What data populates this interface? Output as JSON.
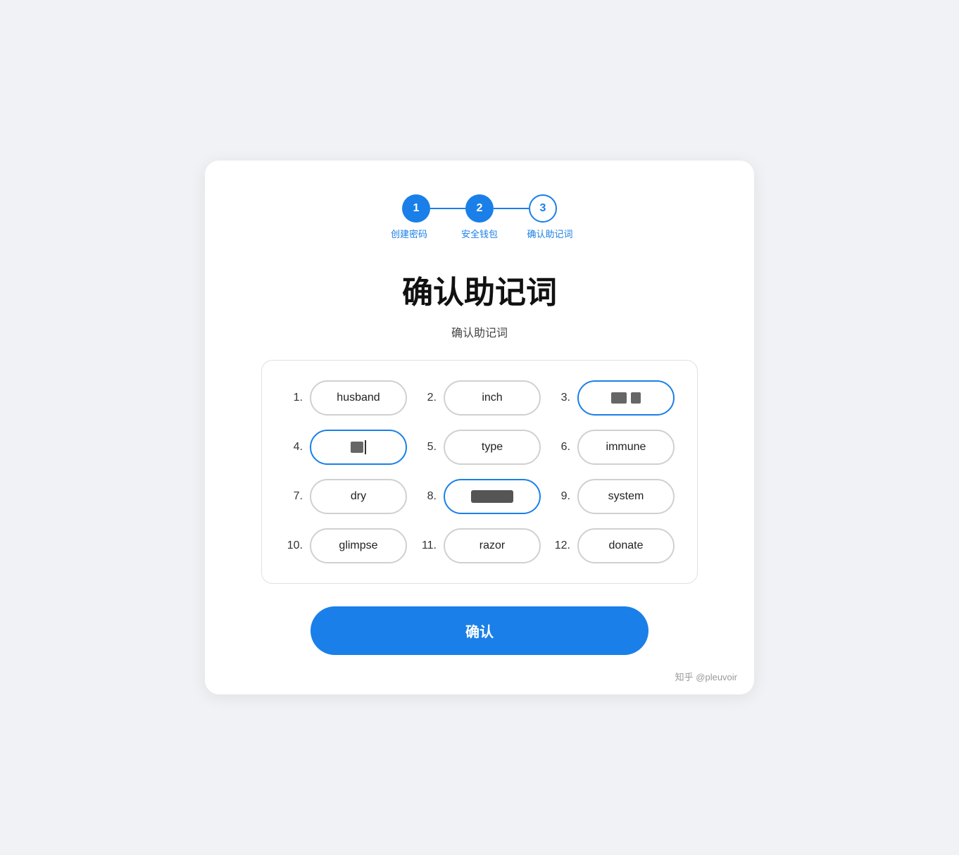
{
  "stepper": {
    "steps": [
      {
        "number": "1",
        "label": "创建密码",
        "style": "active"
      },
      {
        "number": "2",
        "label": "安全钱包",
        "style": "active"
      },
      {
        "number": "3",
        "label": "确认助记词",
        "style": "outline"
      }
    ]
  },
  "main_title": "确认助记词",
  "sub_title": "确认助记词",
  "words": [
    {
      "number": "1.",
      "word": "husband",
      "style": "normal"
    },
    {
      "number": "2.",
      "word": "inch",
      "style": "normal"
    },
    {
      "number": "3.",
      "word": "censored",
      "style": "blue-outline"
    },
    {
      "number": "4.",
      "word": "censored-single",
      "style": "blue-outline"
    },
    {
      "number": "5.",
      "word": "type",
      "style": "normal"
    },
    {
      "number": "6.",
      "word": "immune",
      "style": "normal"
    },
    {
      "number": "7.",
      "word": "dry",
      "style": "normal"
    },
    {
      "number": "8.",
      "word": "censored-input",
      "style": "blue-typing"
    },
    {
      "number": "9.",
      "word": "system",
      "style": "normal"
    },
    {
      "number": "10.",
      "word": "glimpse",
      "style": "normal"
    },
    {
      "number": "11.",
      "word": "razor",
      "style": "normal"
    },
    {
      "number": "12.",
      "word": "donate",
      "style": "normal"
    }
  ],
  "confirm_button": "确认",
  "watermark": "知乎 @pleuvoir"
}
